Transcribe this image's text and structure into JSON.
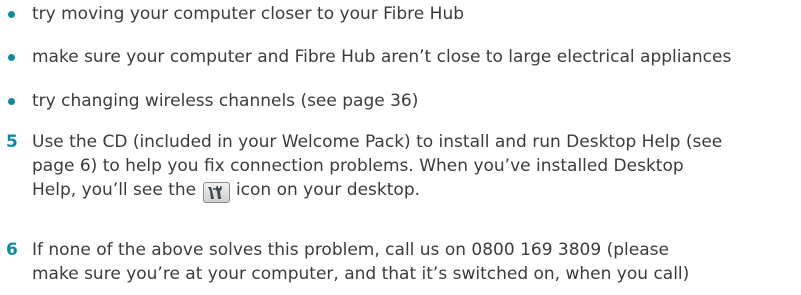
{
  "colors": {
    "accent": "#0a8aa5",
    "text": "#3b3b3b"
  },
  "bullets": [
    "try moving your computer closer to your Fibre Hub",
    "make sure your computer and Fibre Hub aren’t close to large electrical appliances",
    "try changing wireless channels (see page 36)"
  ],
  "steps": [
    {
      "number": "5",
      "lines": [
        "Use the CD (included in your Welcome Pack) to install and run Desktop Help (see",
        "page 6) to help you fix connection problems. When you’ve installed Desktop"
      ],
      "last_line_before_icon": "Help, you’ll see the",
      "icon": "desktop-help-tools-icon",
      "last_line_after_icon": "icon on your desktop."
    },
    {
      "number": "6",
      "lines": [
        "If none of the above solves this problem, call us on 0800 169 3809 (please",
        "make sure you’re at your computer, and that it’s switched on, when you call)"
      ]
    }
  ]
}
